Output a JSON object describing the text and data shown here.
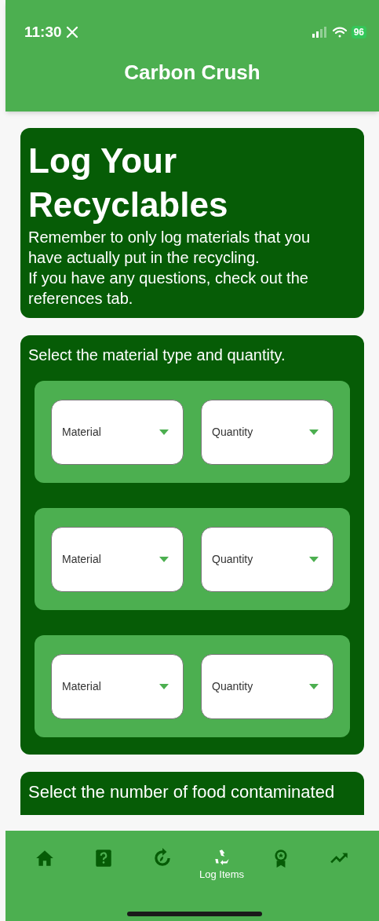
{
  "status_bar": {
    "time": "11:30",
    "battery": "96"
  },
  "header": {
    "title": "Carbon Crush"
  },
  "intro": {
    "title": "Log Your Recyclables",
    "lines": [
      "Remember to only log materials that you have actually put in the recycling.",
      "If you have any questions, check out the references tab."
    ]
  },
  "selection": {
    "prompt": "Select the material type and quantity.",
    "rows": [
      {
        "material": {
          "placeholder": "Material"
        },
        "quantity": {
          "placeholder": "Quantity"
        }
      },
      {
        "material": {
          "placeholder": "Material"
        },
        "quantity": {
          "placeholder": "Quantity"
        }
      },
      {
        "material": {
          "placeholder": "Material"
        },
        "quantity": {
          "placeholder": "Quantity"
        }
      }
    ]
  },
  "contamination": {
    "prompt": "Select the number of food contaminated"
  },
  "bottom_nav": [
    {
      "selected": false
    },
    {
      "selected": false
    },
    {
      "selected": false
    },
    {
      "label": "Log Items",
      "selected": true
    },
    {
      "selected": false
    },
    {
      "selected": false
    }
  ]
}
